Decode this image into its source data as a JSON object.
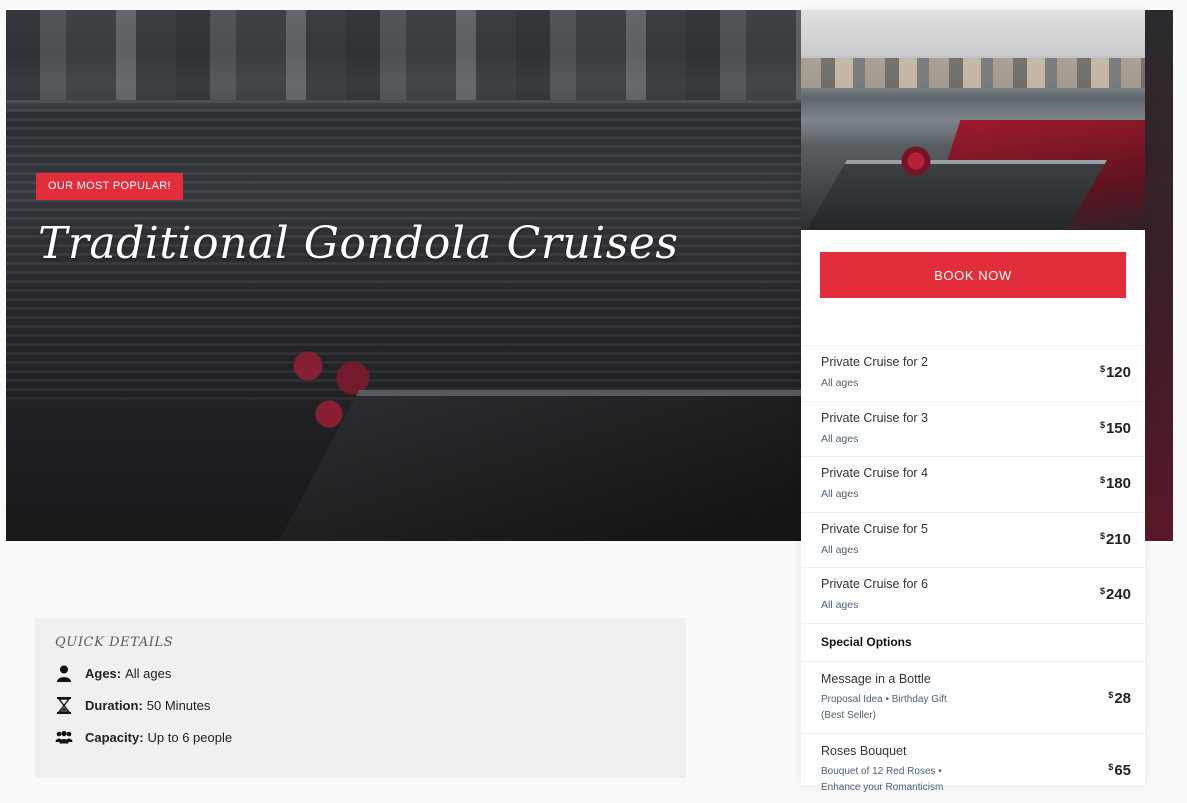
{
  "hero": {
    "badge": "OUR MOST POPULAR!",
    "title": "Traditional Gondola Cruises"
  },
  "sidebar": {
    "book_button": "BOOK NOW",
    "cruises": [
      {
        "name": "Private Cruise for 2",
        "sub": "All ages",
        "currency": "$",
        "price": "120"
      },
      {
        "name": "Private Cruise for 3",
        "sub": "All ages",
        "currency": "$",
        "price": "150"
      },
      {
        "name": "Private Cruise for 4",
        "sub": "All ages",
        "currency": "$",
        "price": "180"
      },
      {
        "name": "Private Cruise for 5",
        "sub": "All ages",
        "currency": "$",
        "price": "210"
      },
      {
        "name": "Private Cruise for 6",
        "sub": "All ages",
        "currency": "$",
        "price": "240"
      }
    ],
    "special_heading": "Special Options",
    "options": [
      {
        "name": "Message in a Bottle",
        "sub": "Proposal Idea • Birthday Gift (Best Seller)",
        "currency": "$",
        "price": "28"
      },
      {
        "name": "Roses Bouquet",
        "sub": "Bouquet of 12 Red Roses • Enhance your Romanticism",
        "currency": "$",
        "price": "65"
      }
    ]
  },
  "quick_details": {
    "title": "QUICK DETAILS",
    "items": [
      {
        "icon": "person-icon",
        "label": "Ages:",
        "value": "All ages"
      },
      {
        "icon": "hourglass-icon",
        "label": "Duration:",
        "value": "50 Minutes"
      },
      {
        "icon": "group-icon",
        "label": "Capacity:",
        "value": "Up to 6 people"
      }
    ]
  },
  "colors": {
    "accent": "#e12e3a",
    "subtext": "#4e6073"
  }
}
